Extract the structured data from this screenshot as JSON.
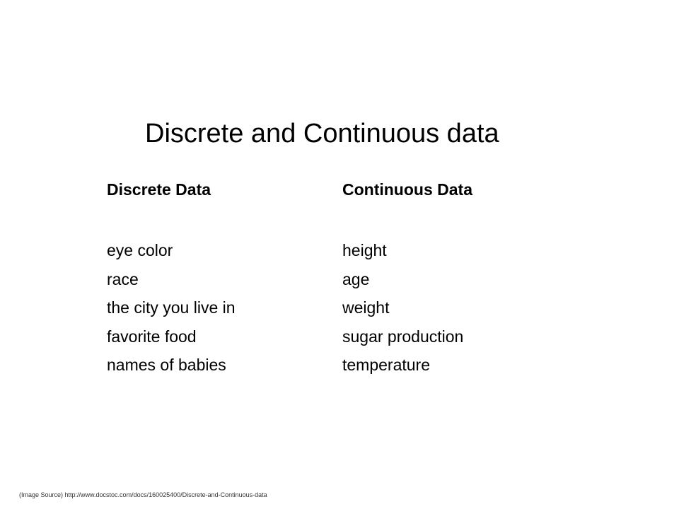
{
  "slide": {
    "title": "Discrete and Continuous data",
    "discrete": {
      "heading": "Discrete Data",
      "items": [
        "eye color",
        "race",
        "the city you live in",
        "favorite food",
        "names of babies"
      ]
    },
    "continuous": {
      "heading": "Continuous Data",
      "items": [
        "height",
        "age",
        "weight",
        "sugar production",
        "temperature"
      ]
    },
    "source": "(Image Source) http://www.docstoc.com/docs/160025400/Discrete-and-Continuous-data"
  }
}
